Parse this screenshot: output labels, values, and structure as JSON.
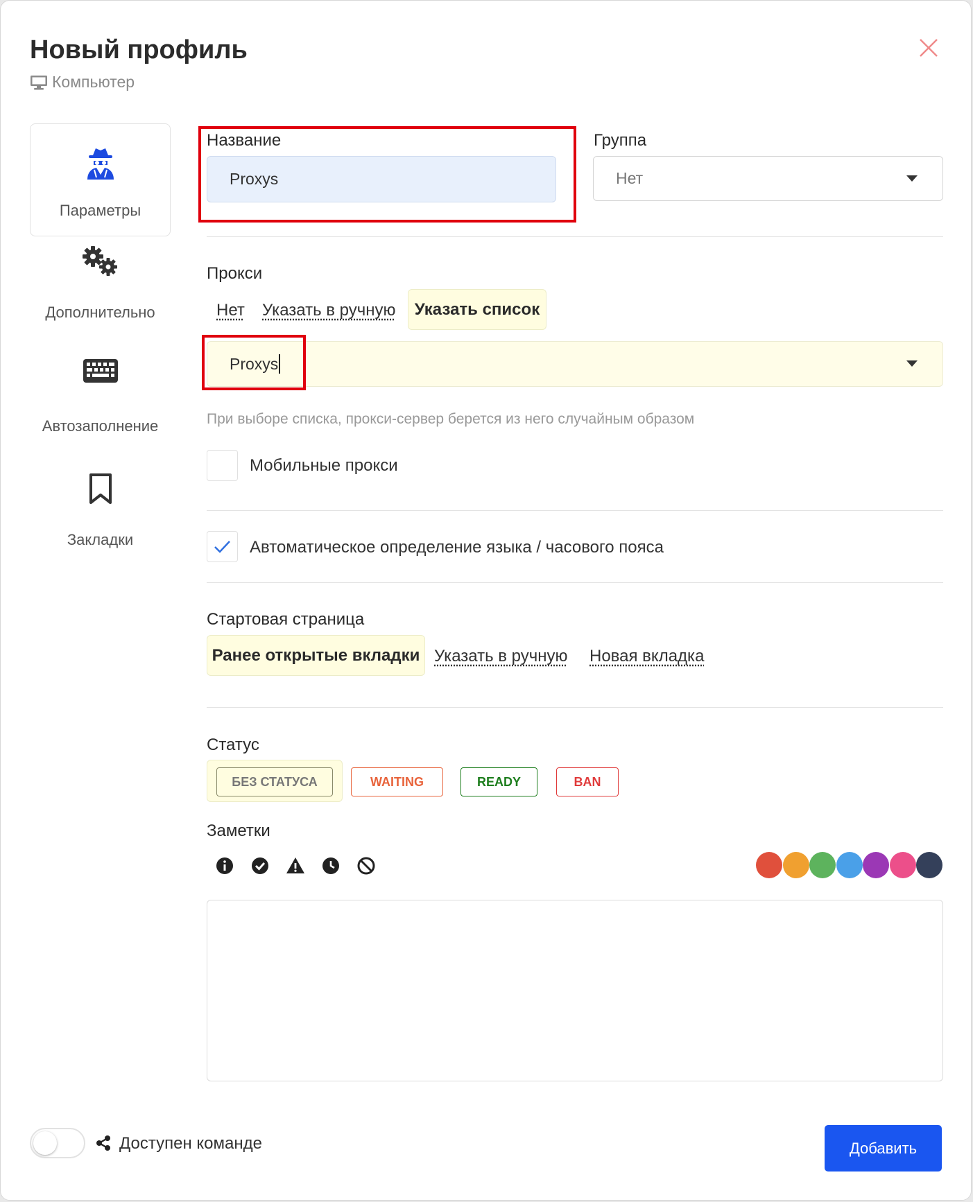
{
  "dialog": {
    "title": "Новый профиль",
    "subtitle": "Компьютер"
  },
  "nav": {
    "items": [
      {
        "label": "Параметры",
        "icon": "spy-icon",
        "active": true
      },
      {
        "label": "Дополнительно",
        "icon": "gears-icon"
      },
      {
        "label": "Автозаполнение",
        "icon": "keyboard-icon"
      },
      {
        "label": "Закладки",
        "icon": "bookmark-icon"
      }
    ]
  },
  "form": {
    "name": {
      "label": "Название",
      "value": "Proxys"
    },
    "group": {
      "label": "Группа",
      "value": "Нет"
    },
    "proxy": {
      "label": "Прокси",
      "options": [
        "Нет",
        "Указать в ручную",
        "Указать список"
      ],
      "selected": "Указать список",
      "list_value": "Proxys",
      "hint": "При выборе списка, прокси-сервер берется из него случайным образом",
      "mobile_label": "Мобильные прокси",
      "mobile_checked": false
    },
    "auto_detect": {
      "label": "Автоматическое определение языка / часового пояса",
      "checked": true
    },
    "start_page": {
      "label": "Стартовая страница",
      "options": [
        "Ранее открытые вкладки",
        "Указать в ручную",
        "Новая вкладка"
      ],
      "selected": "Ранее открытые вкладки"
    },
    "status": {
      "label": "Статус",
      "options": [
        {
          "label": "БЕЗ СТАТУСА",
          "color": "#777777"
        },
        {
          "label": "WAITING",
          "color": "#e8643c"
        },
        {
          "label": "READY",
          "color": "#1e7e1e"
        },
        {
          "label": "BAN",
          "color": "#e03b3b"
        }
      ],
      "selected": "БЕЗ СТАТУСА"
    },
    "notes": {
      "label": "Заметки",
      "icons": [
        "info-icon",
        "check-circle-icon",
        "warning-icon",
        "clock-icon",
        "ban-icon"
      ],
      "colors": [
        "#e0503c",
        "#f0a030",
        "#5db35d",
        "#4aa0e8",
        "#9b38b5",
        "#ec4f8a",
        "#34405a"
      ],
      "value": ""
    }
  },
  "footer": {
    "share_label": "Доступен команде",
    "share_enabled": false,
    "submit_label": "Добавить"
  },
  "colors": {
    "accent": "#1a56f0",
    "highlight": "#e0000d",
    "selected_bg": "#fffde0",
    "name_input_bg": "#e8f0fc"
  }
}
